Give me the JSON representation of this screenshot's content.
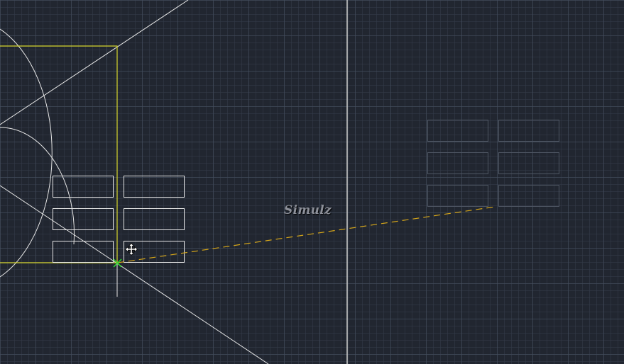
{
  "app": {
    "watermark_text": "Simulz"
  },
  "colors": {
    "background": "#212630",
    "grid_major": "#465060",
    "grid_minor": "#343c4a",
    "geometry_white": "#e6e6e6",
    "selection_yellow": "#d6d62e",
    "tracking_dashed": "#d4a51a",
    "snap_marker_green": "#2ee02e",
    "ghost_preview": "#4e5663"
  },
  "icons": {
    "cursor": "move-cursor-icon",
    "snap": "endpoint-snap-icon"
  }
}
